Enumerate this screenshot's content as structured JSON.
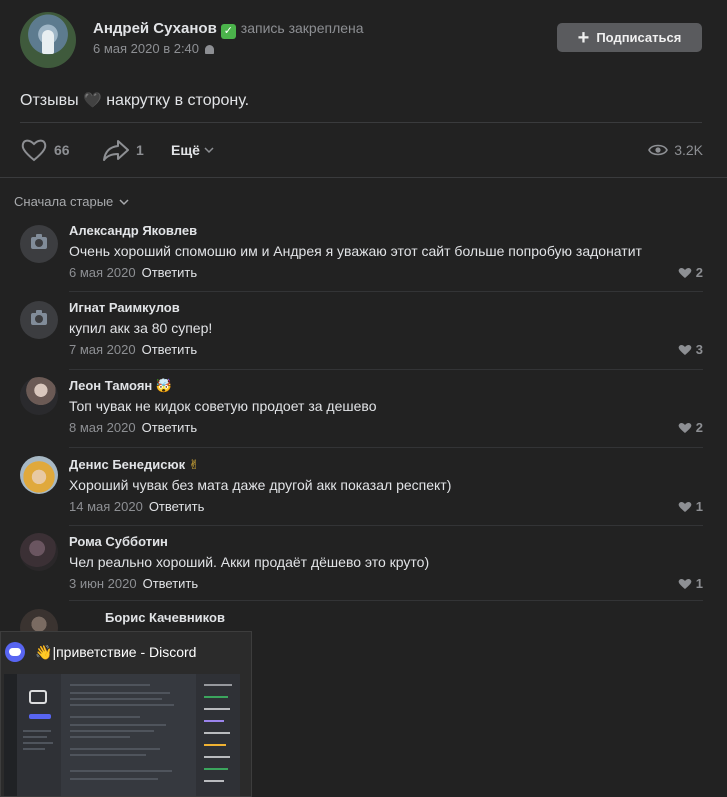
{
  "post": {
    "author": "Андрей Суханов",
    "verified_mark": "✓",
    "pinned_label": "запись закреплена",
    "date": "6 мая 2020 в 2:40",
    "subscribe_label": "Подписаться",
    "subscribe_plus": "+",
    "text_before": "Отзывы",
    "text_emoji": "🖤",
    "text_after": "накрутку в сторону.",
    "likes": "66",
    "shares": "1",
    "more_label": "Ещё",
    "views": "3.2K"
  },
  "sort_label": "Сначала старые",
  "comments": [
    {
      "name": "Александр Яковлев",
      "emoji": "",
      "text": "Очень хороший спомошю им и Андрея я уважаю этот сайт больше попробую задонатит",
      "date": "6 мая 2020",
      "likes": "2",
      "avatar": "camera-placeholder"
    },
    {
      "name": "Игнат Раимкулов",
      "emoji": "",
      "text": "купил акк за 80 супер!",
      "date": "7 мая 2020",
      "likes": "3",
      "avatar": "camera-placeholder"
    },
    {
      "name": "Леон Тамоян",
      "emoji": "🤯",
      "text": "Топ чувак не кидок советую продоет за дешево",
      "date": "8 мая 2020",
      "likes": "2",
      "avatar": "photo"
    },
    {
      "name": "Денис Бенедисюк",
      "emoji": "✌",
      "text": "Хороший чувак без мата даже другой акк показал респект)",
      "date": "14 мая 2020",
      "likes": "1",
      "avatar": "photo"
    },
    {
      "name": "Рома Субботин",
      "emoji": "",
      "text": "Чел реально хороший. Акки продаёт дёшево это круто)",
      "date": "3 июн 2020",
      "likes": "1",
      "avatar": "photo"
    },
    {
      "name": "Борис Качевников",
      "emoji": "",
      "text": "",
      "date": "",
      "likes": "",
      "avatar": "photo"
    }
  ],
  "reply_label": "Ответить",
  "discord_preview": {
    "title_icon": "👋",
    "title": "|приветствие - Discord"
  },
  "colors": {
    "background": "#222222",
    "text": "#e1e3e6",
    "muted": "#8d8f93",
    "button": "#5a5b5e",
    "verified": "#4bb34b",
    "discord": "#5865f2"
  }
}
